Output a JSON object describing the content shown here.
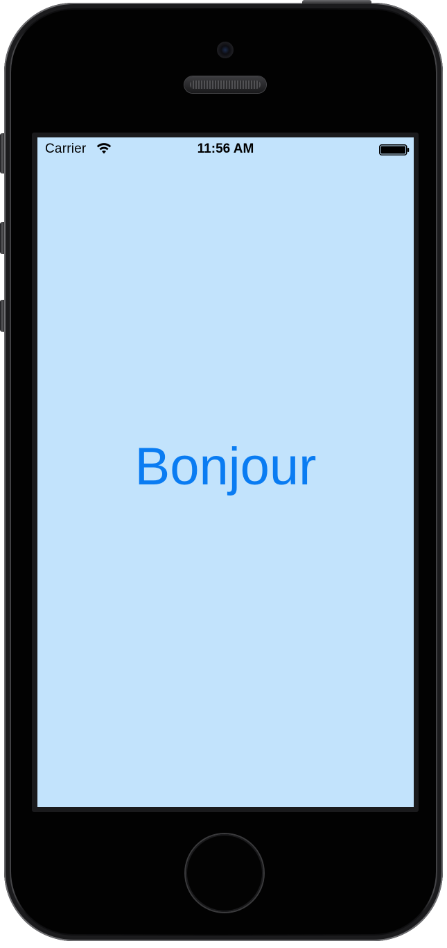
{
  "status_bar": {
    "carrier": "Carrier",
    "time": "11:56 AM",
    "wifi_icon": "wifi-icon",
    "battery_icon": "battery-icon"
  },
  "screen": {
    "greeting": "Bonjour",
    "background_color": "#c2e3fc",
    "greeting_color": "#0a7cf2"
  },
  "device": {
    "home_button_icon": "home-button",
    "camera_icon": "front-camera-icon",
    "speaker_icon": "earpiece-speaker-icon"
  }
}
